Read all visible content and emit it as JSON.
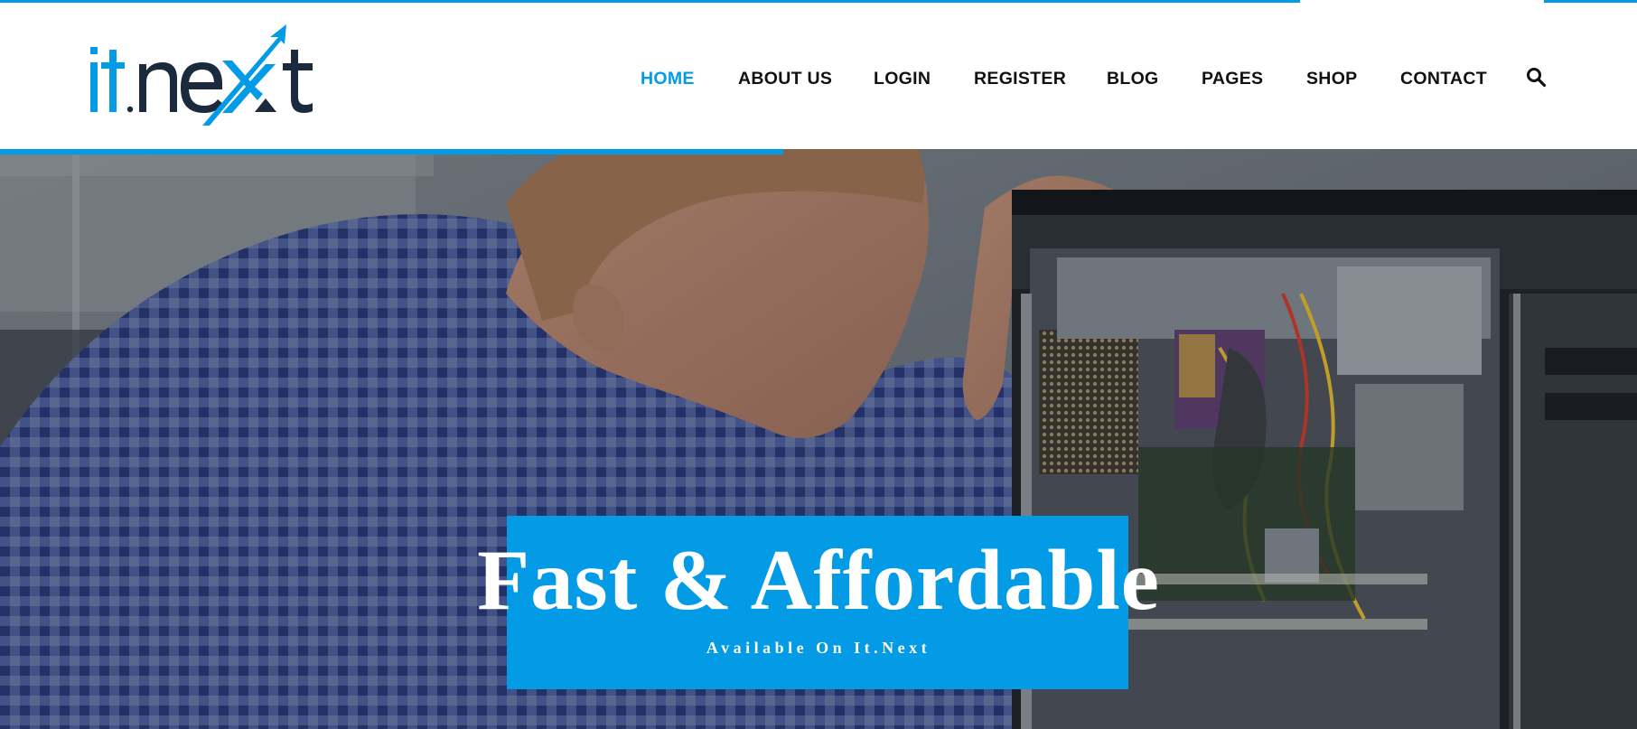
{
  "brand": {
    "logo_text": "it.next",
    "colors": {
      "primary": "#039be5",
      "dark": "#1b2a3c"
    }
  },
  "nav": {
    "items": [
      {
        "label": "HOME",
        "active": true
      },
      {
        "label": "ABOUT US",
        "active": false
      },
      {
        "label": "LOGIN",
        "active": false
      },
      {
        "label": "REGISTER",
        "active": false
      },
      {
        "label": "BLOG",
        "active": false
      },
      {
        "label": "PAGES",
        "active": false
      },
      {
        "label": "SHOP",
        "active": false
      },
      {
        "label": "CONTACT",
        "active": false
      }
    ],
    "search_icon": "search-icon"
  },
  "hero": {
    "title": "Fast & Affordable",
    "subtitle": "Available On It.Next"
  }
}
